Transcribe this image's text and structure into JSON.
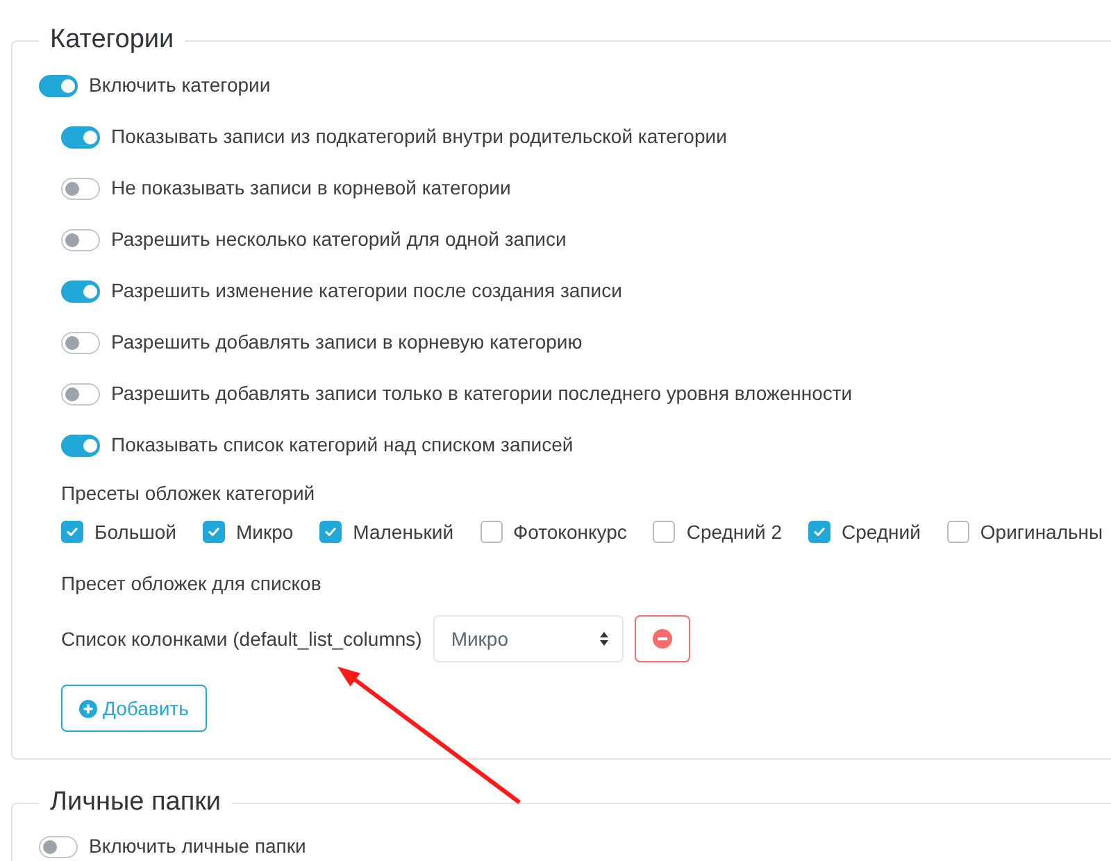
{
  "sections": [
    {
      "title": "Категории",
      "toggle": {
        "label": "Включить категории",
        "on": true
      },
      "settings": [
        {
          "label": "Показывать записи из подкатегорий внутри родительской категории",
          "on": true
        },
        {
          "label": "Не показывать записи в корневой категории",
          "on": false
        },
        {
          "label": "Разрешить несколько категорий для одной записи",
          "on": false
        },
        {
          "label": "Разрешить изменение категории после создания записи",
          "on": true
        },
        {
          "label": "Разрешить добавлять записи в корневую категорию",
          "on": false
        },
        {
          "label": "Разрешить добавлять записи только в категории последнего уровня вложенности",
          "on": false
        },
        {
          "label": "Показывать список категорий над списком записей",
          "on": true
        }
      ],
      "cover_presets": {
        "label": "Пресеты обложек категорий",
        "options": [
          {
            "label": "Большой",
            "checked": true
          },
          {
            "label": "Микро",
            "checked": true
          },
          {
            "label": "Маленький",
            "checked": true
          },
          {
            "label": "Фотоконкурс",
            "checked": false
          },
          {
            "label": "Средний 2",
            "checked": false
          },
          {
            "label": "Средний",
            "checked": true
          },
          {
            "label": "Оригинальны",
            "checked": false
          }
        ]
      },
      "list_presets": {
        "label": "Пресет обложек для списков",
        "rows": [
          {
            "label": "Список колонками (default_list_columns)",
            "value": "Микро"
          }
        ],
        "add_button": "Добавить"
      }
    },
    {
      "title": "Личные папки",
      "toggle": {
        "label": "Включить личные папки",
        "on": false
      }
    }
  ],
  "annotations": [
    {
      "kind": "arrow"
    }
  ]
}
